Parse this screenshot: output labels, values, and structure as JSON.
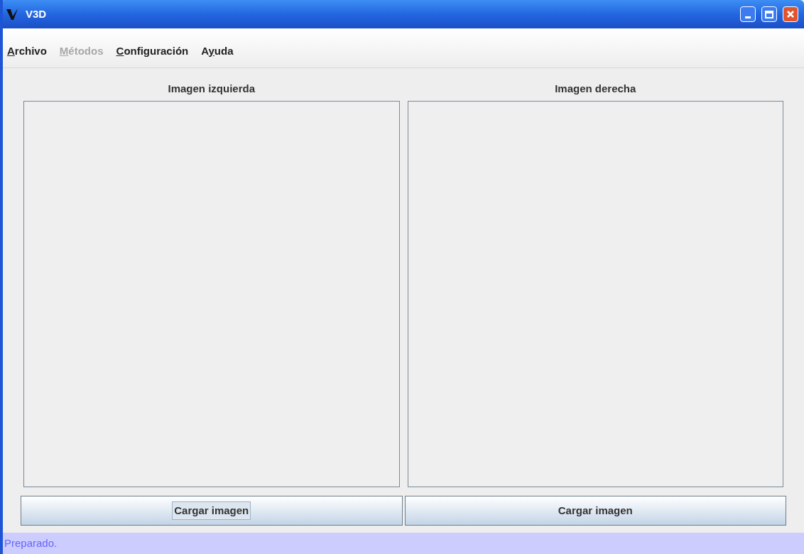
{
  "window": {
    "title": "V3D"
  },
  "menu": [
    {
      "key": "A",
      "after": "rchivo",
      "disabled": false
    },
    {
      "key": "M",
      "after": "étodos",
      "disabled": true
    },
    {
      "key": "C",
      "after": "onfiguración",
      "disabled": false
    },
    {
      "before": "A",
      "key": "y",
      "after": "uda",
      "disabled": false
    }
  ],
  "panels": [
    {
      "title": "Imagen izquierda",
      "button": "Cargar imagen",
      "focused": true
    },
    {
      "title": "Imagen derecha",
      "button": "Cargar imagen",
      "focused": false
    }
  ],
  "status_bar": "Preparado."
}
